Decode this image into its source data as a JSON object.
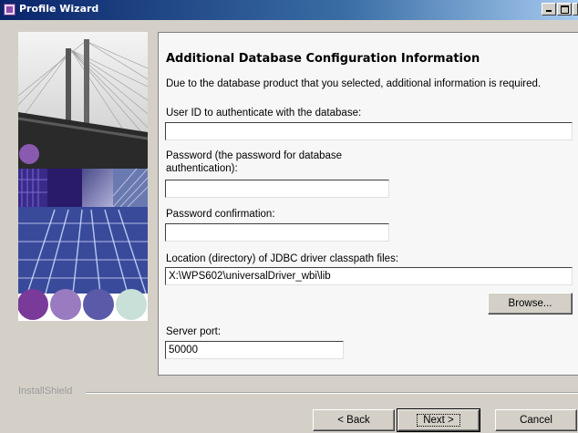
{
  "window": {
    "title": "Profile Wizard"
  },
  "panel": {
    "heading": "Additional Database Configuration Information",
    "description": "Due to the database product that you selected, additional information is required."
  },
  "fields": {
    "user_id": {
      "label": "User ID to authenticate with the database:",
      "value": ""
    },
    "password": {
      "label_line1": "Password (the password for database",
      "label_line2": "authentication):",
      "value": ""
    },
    "password_confirm": {
      "label": "Password confirmation:",
      "value": ""
    },
    "jdbc_location": {
      "label": "Location (directory) of JDBC driver classpath files:",
      "value": "X:\\WPS602\\universalDriver_wbi\\lib"
    },
    "server_port": {
      "label": "Server port:",
      "value": "50000"
    }
  },
  "buttons": {
    "browse": "Browse...",
    "back": "< Back",
    "next": "Next >",
    "cancel": "Cancel"
  },
  "footer": {
    "brand": "InstallShield"
  },
  "icons": {
    "window_icon": "wizard-icon",
    "minimize": "minimize-icon",
    "maximize": "maximize-icon"
  },
  "colors": {
    "titlebar": "#0a246a",
    "dialog_bg": "#d4d0c8",
    "panel_bg": "#f7f7f7",
    "accent_purple": "#7a4aa0"
  }
}
